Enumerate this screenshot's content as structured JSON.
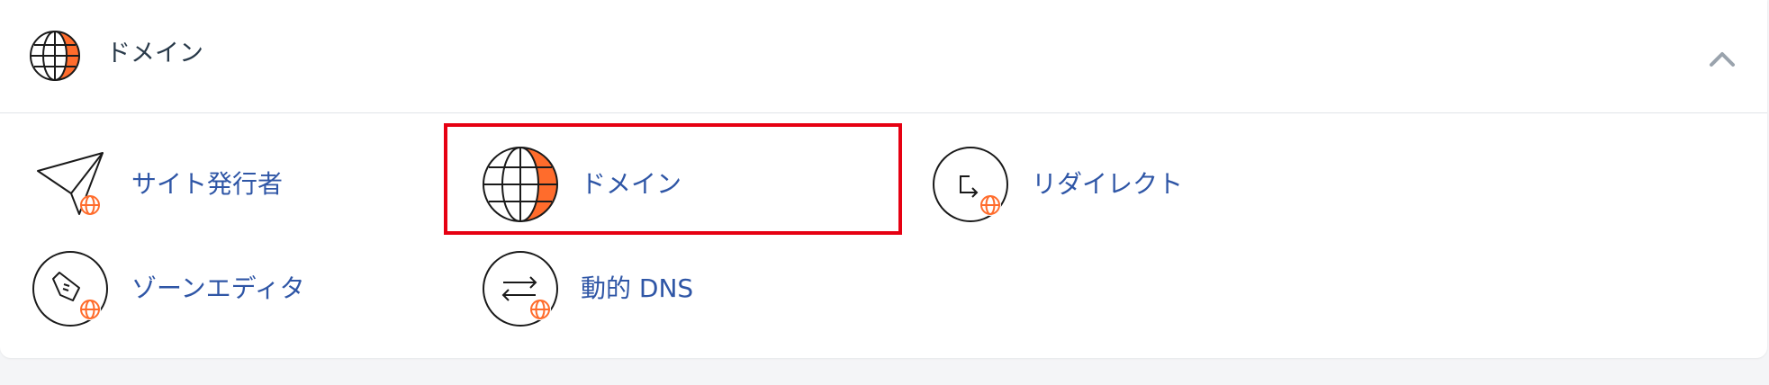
{
  "section": {
    "title": "ドメイン",
    "icon": "globe-icon",
    "collapse_icon": "chevron-up-icon"
  },
  "items": [
    {
      "label": "サイト発行者",
      "icon": "paper-plane-globe-icon"
    },
    {
      "label": "ドメイン",
      "icon": "globe-icon",
      "highlighted": true
    },
    {
      "label": "リダイレクト",
      "icon": "redirect-arrow-icon"
    },
    {
      "label": "ゾーンエディタ",
      "icon": "pen-nib-globe-icon"
    },
    {
      "label": "動的 DNS",
      "icon": "swap-arrows-globe-icon"
    }
  ],
  "colors": {
    "accent": "#ff6c2c",
    "link": "#2f56a6",
    "title": "#293a4a",
    "highlight_border": "#e60012"
  }
}
